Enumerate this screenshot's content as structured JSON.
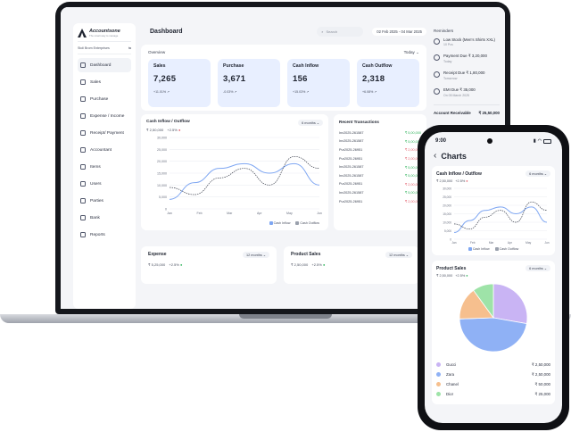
{
  "sidebar": {
    "brand": "Accountsone",
    "tagline": "The smart way to manage",
    "org": "Stoli Brom Enterprises",
    "items": [
      {
        "label": "Dashboard",
        "icon": "grid-icon"
      },
      {
        "label": "Sales",
        "icon": "receipt-icon"
      },
      {
        "label": "Purchase",
        "icon": "cart-icon"
      },
      {
        "label": "Expense / Income",
        "icon": "wallet-icon"
      },
      {
        "label": "Receipt/ Payment",
        "icon": "card-icon"
      },
      {
        "label": "Accountant",
        "icon": "calculator-icon"
      },
      {
        "label": "Items",
        "icon": "box-icon"
      },
      {
        "label": "Users",
        "icon": "user-icon"
      },
      {
        "label": "Parties",
        "icon": "users-icon"
      },
      {
        "label": "Bank",
        "icon": "bank-icon"
      },
      {
        "label": "Reports",
        "icon": "chart-icon"
      }
    ]
  },
  "header": {
    "title": "Dashboard",
    "search_placeholder": "Search",
    "date_range": "02 Feb 2025 - 04 Mar 2025"
  },
  "overview": {
    "label": "Overview",
    "period": "Today",
    "cards": [
      {
        "title": "Sales",
        "value": "7,265",
        "delta": "+11.01%"
      },
      {
        "title": "Purchase",
        "value": "3,671",
        "delta": "-0.03%"
      },
      {
        "title": "Cash Inflow",
        "value": "156",
        "delta": "+15.03%"
      },
      {
        "title": "Cash Outflow",
        "value": "2,318",
        "delta": "+6.08%"
      }
    ]
  },
  "cash_chart": {
    "title": "Cash Inflow / Outflow",
    "period": "6 months",
    "total": "₹ 2,50,000",
    "change": "+2.5%",
    "legend_inflow": "Cash Inflow",
    "legend_outflow": "Cash Outflow"
  },
  "chart_data": {
    "type": "line",
    "title": "Cash Inflow / Outflow",
    "categories": [
      "Jan",
      "Feb",
      "Mar",
      "Apr",
      "May",
      "Jun"
    ],
    "y_ticks": [
      "30,000",
      "25,000",
      "20,000",
      "15,000",
      "10,000",
      "5,000",
      "0"
    ],
    "ylim": [
      0,
      30000
    ],
    "series": [
      {
        "name": "Cash Inflow",
        "color": "#7ea6f2",
        "values": [
          4000,
          11000,
          17000,
          19000,
          15000,
          19000,
          10000
        ]
      },
      {
        "name": "Cash Outflow",
        "color": "#3a3f4c",
        "values": [
          9000,
          6000,
          13000,
          17000,
          10000,
          22000,
          17000
        ]
      }
    ],
    "grid": true,
    "legend": "bottom-right"
  },
  "transactions": {
    "title": "Recent Transactions",
    "rows": [
      {
        "id": "Inv2025-261587",
        "amount": "₹ 5,00,000",
        "positive": true
      },
      {
        "id": "Inv2025-261587",
        "amount": "₹ 5,00,000",
        "positive": true
      },
      {
        "id": "Pur2025-26951",
        "amount": "₹ 2,00,000",
        "positive": false
      },
      {
        "id": "Pur2025-26951",
        "amount": "₹ 2,00,000",
        "positive": false
      },
      {
        "id": "Inv2025-261587",
        "amount": "₹ 5,00,000",
        "positive": true
      },
      {
        "id": "Inv2025-261587",
        "amount": "₹ 5,00,000",
        "positive": true
      },
      {
        "id": "Pur2025-26951",
        "amount": "₹ 2,00,000",
        "positive": false
      },
      {
        "id": "Inv2025-261587",
        "amount": "₹ 5,00,000",
        "positive": true
      },
      {
        "id": "Pur2025-26951",
        "amount": "₹ 2,00,000",
        "positive": false
      }
    ]
  },
  "expense": {
    "title": "Expense",
    "period": "12 months",
    "total": "₹ 5,25,000",
    "change": "+2.5%"
  },
  "product_sales": {
    "title": "Product Sales",
    "period": "12 months",
    "total": "₹ 2,50,000",
    "change": "+2.5%"
  },
  "reminders": {
    "title": "Reminders",
    "items": [
      {
        "main": "Low Stock (Men's Shirts XXL)",
        "sub": "10 Pcs"
      },
      {
        "main": "Payment Due ₹ 3,20,000",
        "sub": "Today"
      },
      {
        "main": "Receipt Due ₹ 1,80,000",
        "sub": "Tomorrow"
      },
      {
        "main": "EMI Due ₹ 35,000",
        "sub": "On 05 March 2025"
      }
    ],
    "receivable_label": "Account Receivable",
    "receivable_value": "₹ 25,50,000"
  },
  "phone": {
    "time": "9:00",
    "title": "Charts",
    "cash_title": "Cash Inflow / Outflow",
    "cash_period": "6 months",
    "cash_total": "₹ 2,50,000",
    "cash_change": "+2.5%",
    "legend_inflow": "Cash Inflow",
    "legend_outflow": "Cash Outflow",
    "product_title": "Product Sales",
    "product_period": "6 months",
    "product_total": "₹ 2,50,000",
    "product_change": "+2.5%",
    "slices": [
      {
        "name": "Gucci",
        "amount": "₹ 2,50,000",
        "color": "#c9b4f4",
        "value": 250000
      },
      {
        "name": "Zara",
        "amount": "₹ 2,50,000",
        "color": "#8fb1f5",
        "value": 420000
      },
      {
        "name": "Chanel",
        "amount": "₹ 50,000",
        "color": "#f6bf8e",
        "value": 140000
      },
      {
        "name": "Dior",
        "amount": "₹ 25,000",
        "color": "#9ee3a8",
        "value": 90000
      }
    ]
  }
}
